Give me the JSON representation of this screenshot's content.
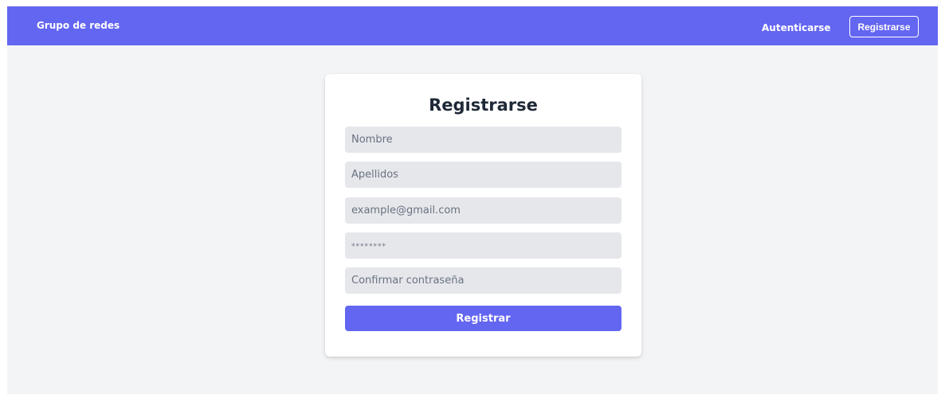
{
  "navbar": {
    "brand": "Grupo de redes",
    "login_label": "Autenticarse",
    "register_label": "Registrarse",
    "background_color": "#6366f1"
  },
  "form": {
    "title": "Registrarse",
    "fields": [
      {
        "name": "nombre",
        "type": "text",
        "value": "",
        "placeholder": "Nombre"
      },
      {
        "name": "apellidos",
        "type": "text",
        "value": "",
        "placeholder": "Apellidos"
      },
      {
        "name": "email",
        "type": "email",
        "value": "",
        "placeholder": "example@gmail.com"
      },
      {
        "name": "password",
        "type": "password",
        "value": "",
        "placeholder": "********"
      },
      {
        "name": "confirm_password",
        "type": "password",
        "value": "",
        "placeholder": "Confirmar contraseña"
      }
    ],
    "submit_label": "Registrar",
    "accent_color": "#6366f1"
  }
}
